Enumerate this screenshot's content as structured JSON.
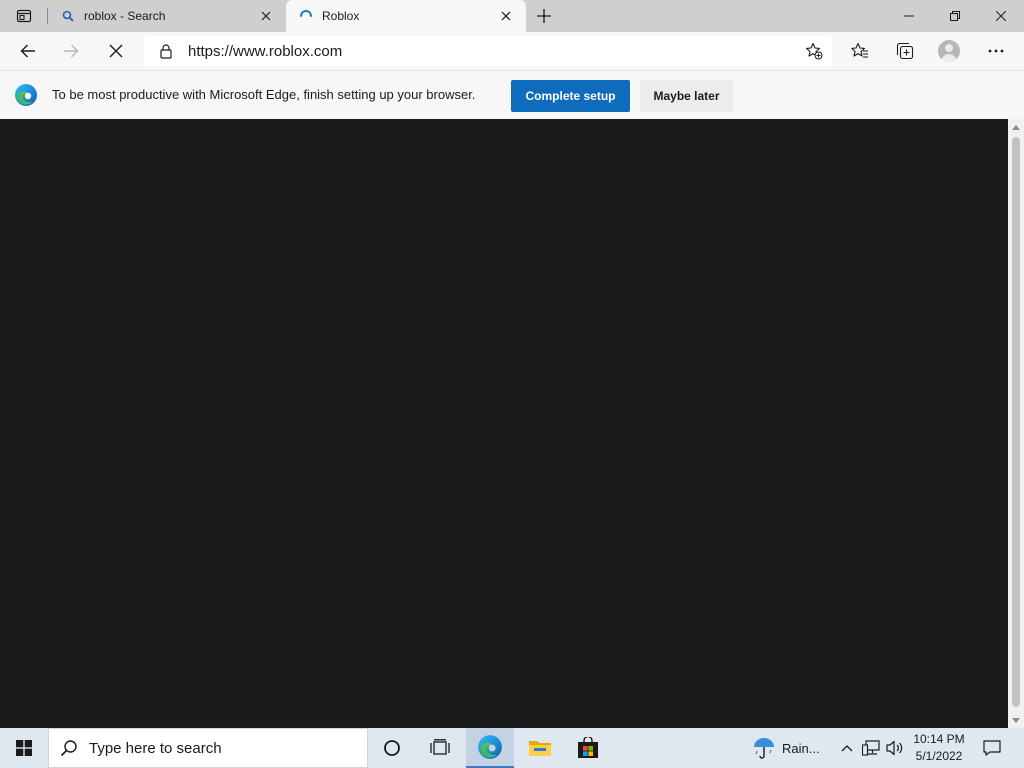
{
  "tabs": [
    {
      "title": "roblox - Search",
      "icon": "search-icon",
      "active": false
    },
    {
      "title": "Roblox",
      "icon": "loading-spinner-icon",
      "active": true
    }
  ],
  "toolbar": {
    "url": "https://www.roblox.com"
  },
  "infobar": {
    "message": "To be most productive with Microsoft Edge, finish setting up your browser.",
    "primary_label": "Complete setup",
    "secondary_label": "Maybe later"
  },
  "taskbar": {
    "search_placeholder": "Type here to search",
    "weather_text": "Rain...",
    "time": "10:14 PM",
    "date": "5/1/2022"
  },
  "colors": {
    "accent": "#0f6cbd",
    "page_background": "#1b1b1d",
    "taskbar": "#dfe7f0"
  }
}
